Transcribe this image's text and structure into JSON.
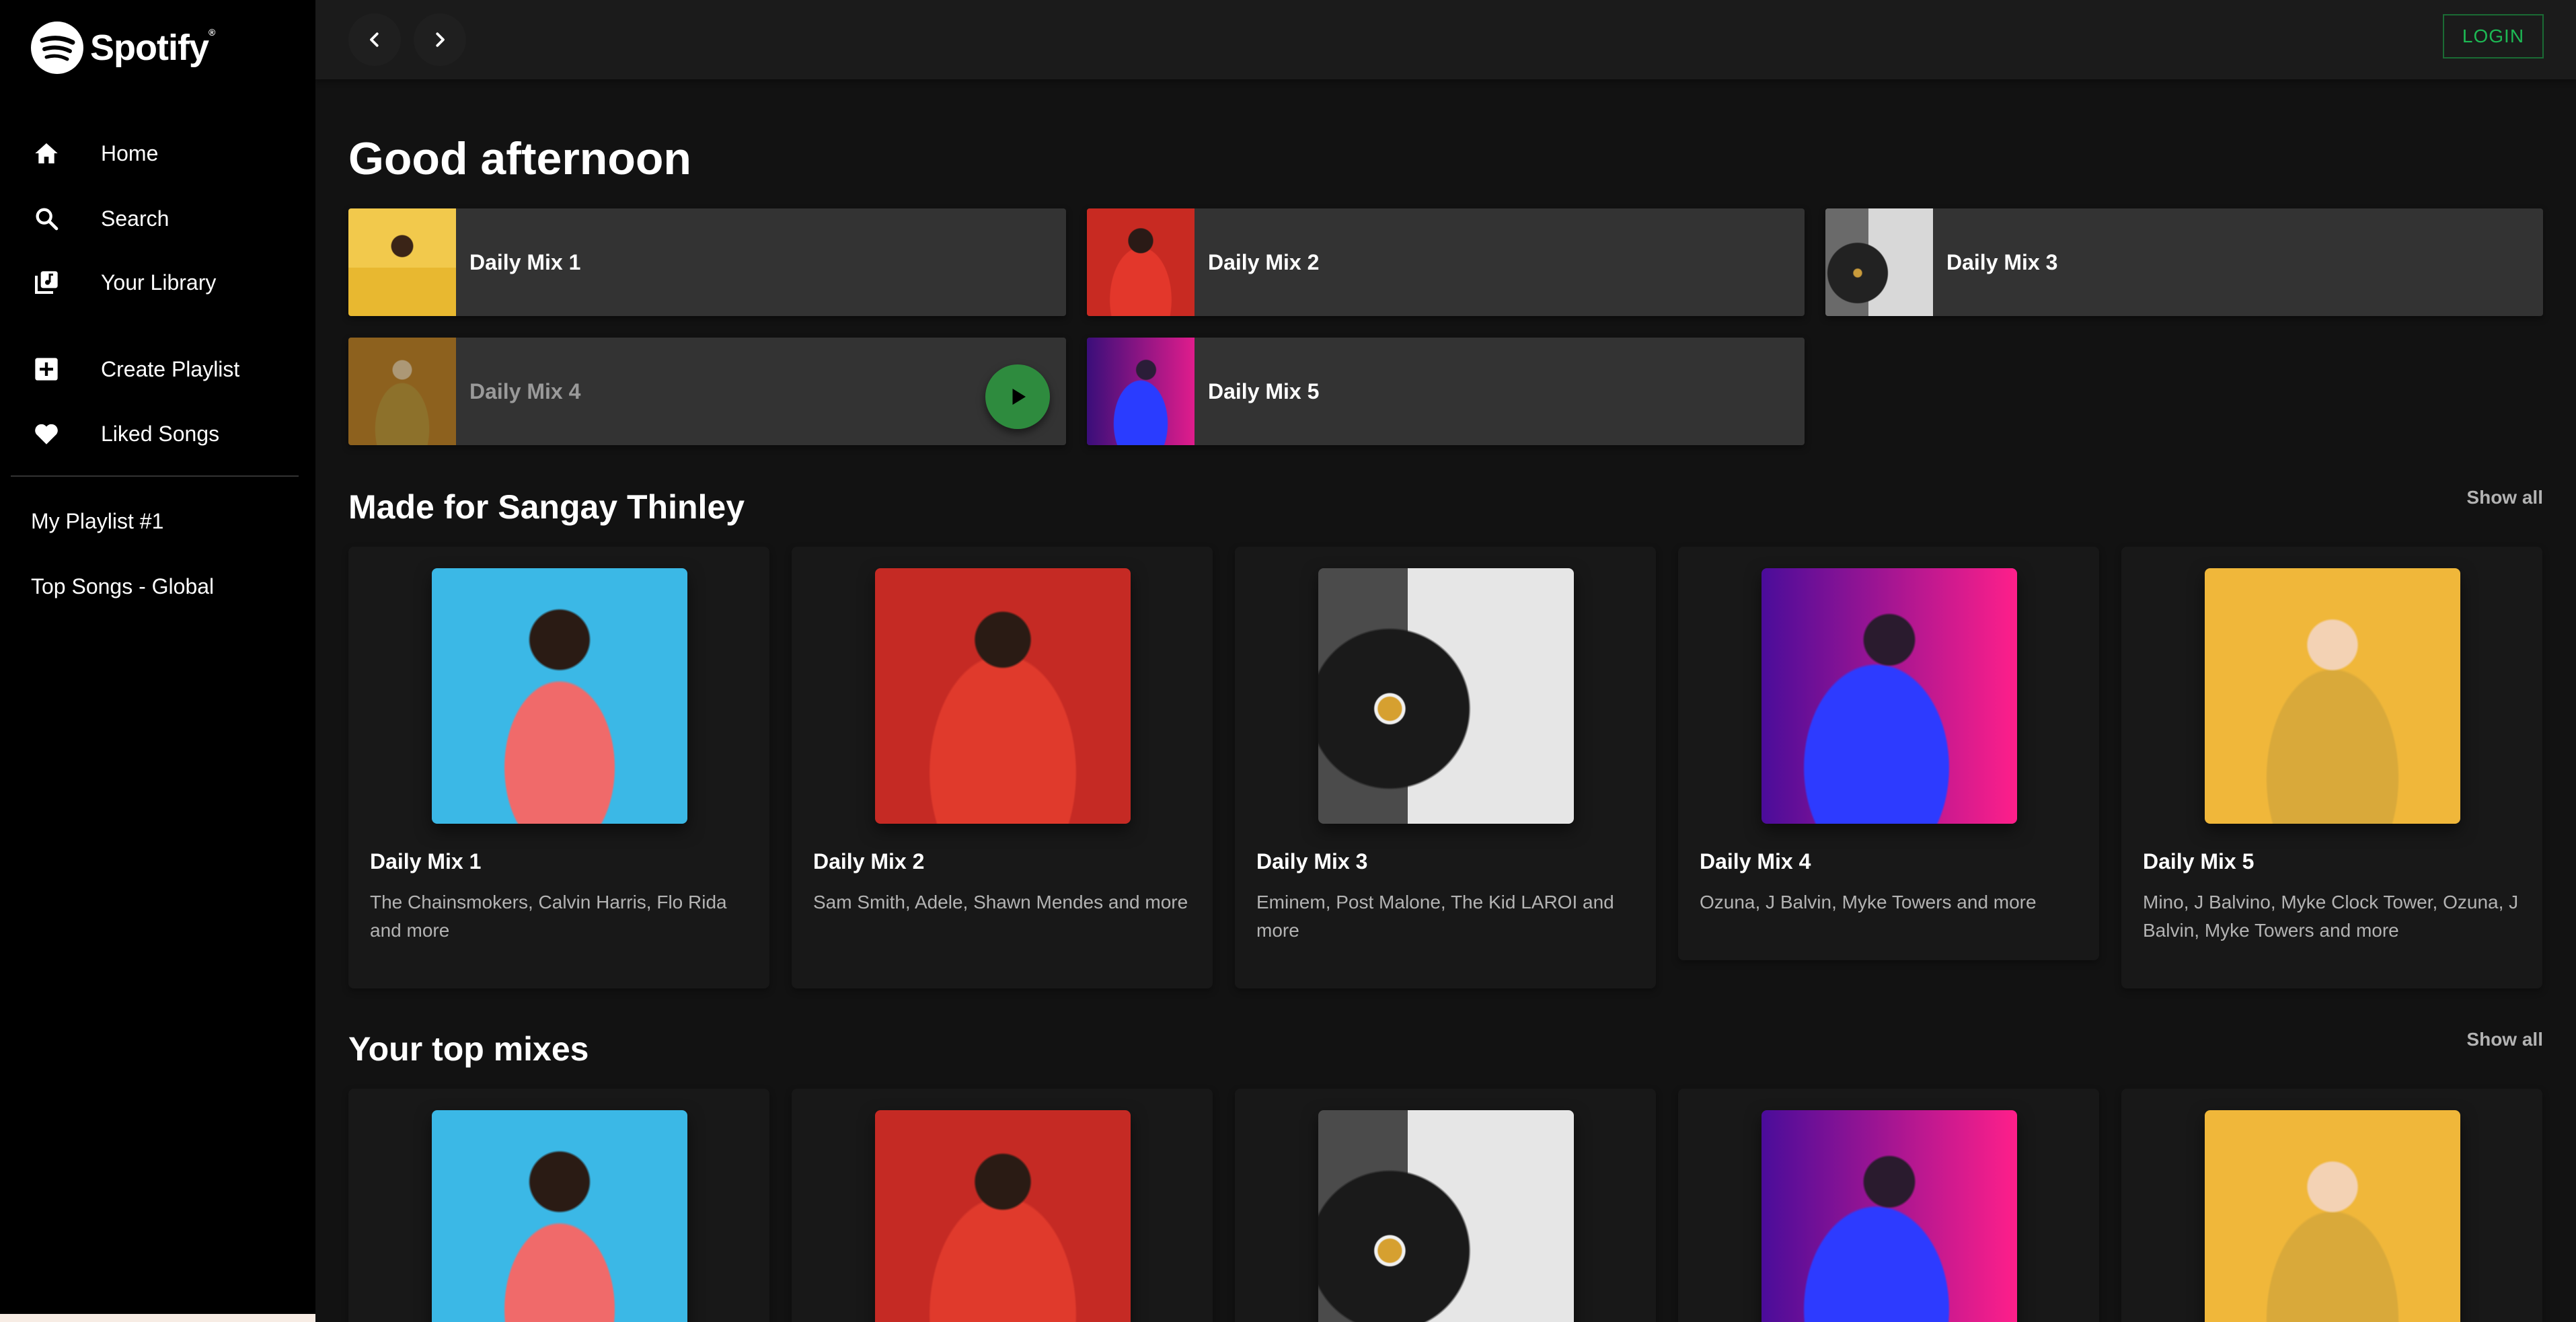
{
  "brand": {
    "name": "Spotify",
    "accent": "#1db954"
  },
  "sidebar": {
    "nav": [
      {
        "label": "Home",
        "icon": "home-icon"
      },
      {
        "label": "Search",
        "icon": "search-icon"
      },
      {
        "label": "Your Library",
        "icon": "library-icon"
      }
    ],
    "actions": [
      {
        "label": "Create Playlist",
        "icon": "plus-square-icon"
      },
      {
        "label": "Liked Songs",
        "icon": "heart-icon"
      }
    ],
    "playlists": [
      "My Playlist #1",
      "Top Songs - Global"
    ]
  },
  "topbar": {
    "login_label": "LOGIN"
  },
  "greeting": "Good afternoon",
  "quick_picks": [
    {
      "label": "Daily Mix 1"
    },
    {
      "label": "Daily Mix 2"
    },
    {
      "label": "Daily Mix 3"
    },
    {
      "label": "Daily Mix 4"
    },
    {
      "label": "Daily Mix 5"
    }
  ],
  "made_for": {
    "title": "Made for Sangay Thinley",
    "show_all": "Show all",
    "cards": [
      {
        "title": "Daily Mix 1",
        "desc": "The Chainsmokers, Calvin Harris, Flo Rida and more"
      },
      {
        "title": "Daily Mix 2",
        "desc": "Sam Smith, Adele, Shawn Mendes and more"
      },
      {
        "title": "Daily Mix 3",
        "desc": "Eminem, Post Malone, The Kid LAROI and more"
      },
      {
        "title": "Daily Mix 4",
        "desc": "Ozuna, J Balvin, Myke Towers and more"
      },
      {
        "title": "Daily Mix 5",
        "desc": "Mino, J Balvino, Myke Clock Tower, Ozuna, J Balvin, Myke Towers and more"
      }
    ]
  },
  "top_mixes": {
    "title": "Your top mixes",
    "show_all": "Show all"
  }
}
